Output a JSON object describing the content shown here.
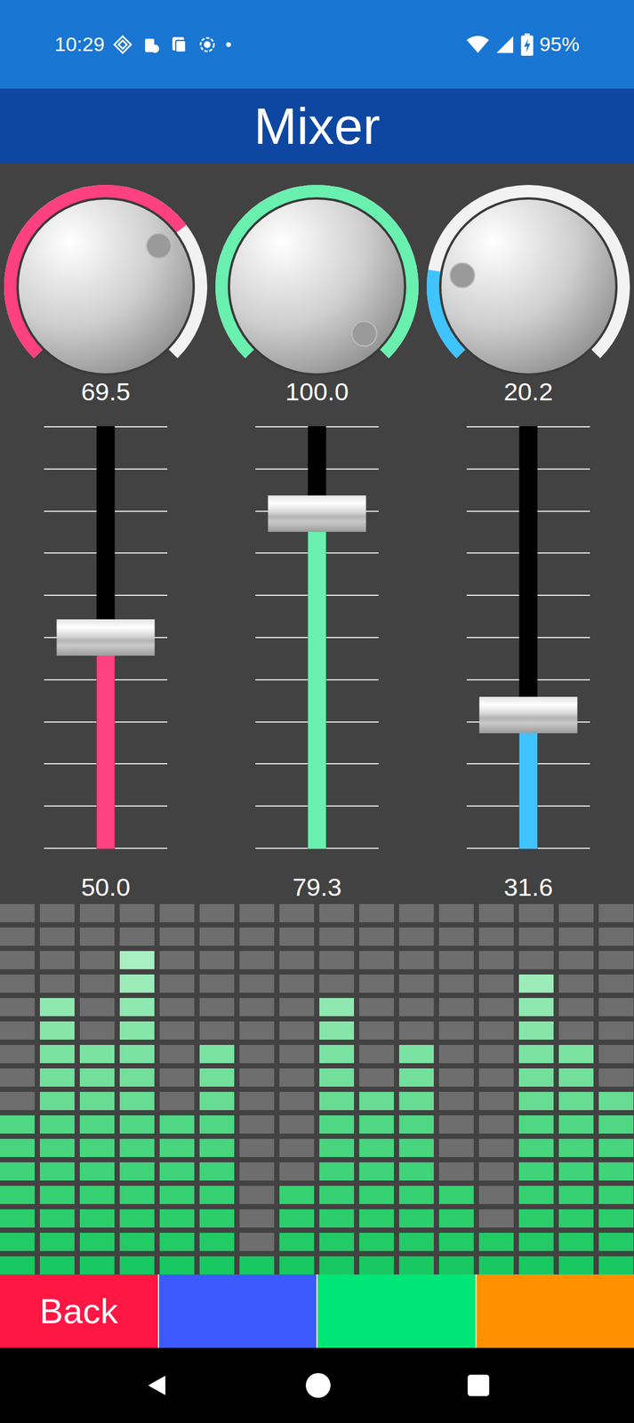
{
  "status_bar": {
    "time": "10:29",
    "dot": "•",
    "battery": "95%"
  },
  "title": "Mixer",
  "knobs": [
    {
      "value": "69.5",
      "level": 0.695,
      "color": "#FF4081"
    },
    {
      "value": "100.0",
      "level": 1.0,
      "color": "#69F0AE"
    },
    {
      "value": "20.2",
      "level": 0.202,
      "color": "#40C4FF"
    }
  ],
  "sliders": [
    {
      "value": "50.0",
      "level": 0.5,
      "color": "#FF4081"
    },
    {
      "value": "79.3",
      "level": 0.793,
      "color": "#69F0AE"
    },
    {
      "value": "31.6",
      "level": 0.316,
      "color": "#40C4FF"
    }
  ],
  "meter": {
    "bars": [
      0.4375,
      0.75,
      0.625,
      0.875,
      0.4375,
      0.625,
      0.0625,
      0.25,
      0.75,
      0.5,
      0.625,
      0.25,
      0.125,
      0.8125,
      0.625,
      0.5
    ]
  },
  "buttons": [
    {
      "label": "Back",
      "color": "#FF1744"
    },
    {
      "label": "",
      "color": "#3D5AFE"
    },
    {
      "label": "",
      "color": "#00E676"
    },
    {
      "label": "",
      "color": "#FF9100"
    }
  ]
}
